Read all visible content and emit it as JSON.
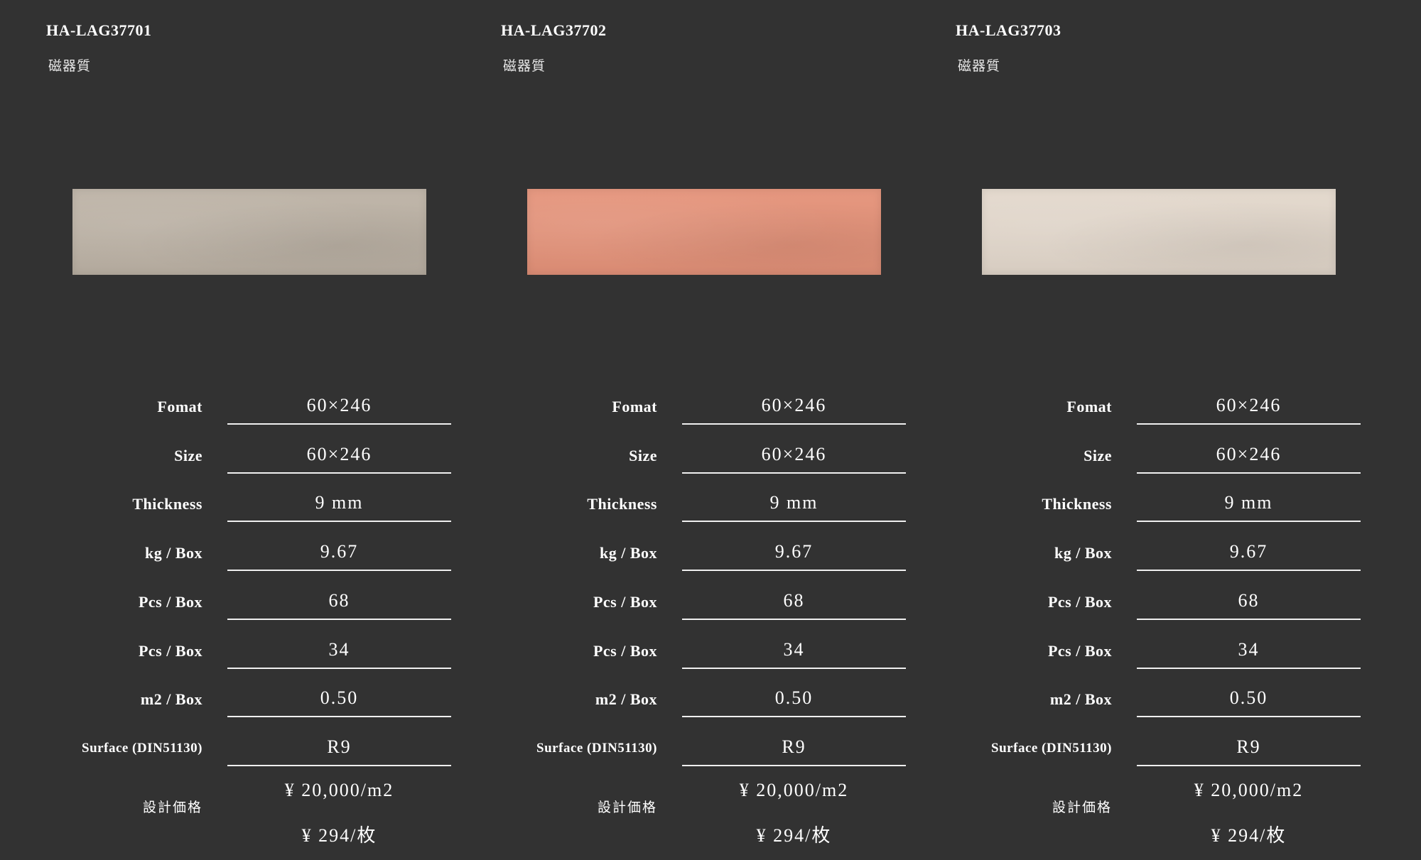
{
  "labels": {
    "format": "Fomat",
    "size": "Size",
    "thickness": "Thickness",
    "kg_box": "kg / Box",
    "pcs_box_1": "Pcs / Box",
    "pcs_box_2": "Pcs / Box",
    "m2_box": "m2 / Box",
    "surface": "Surface (DIN51130)",
    "price": "設計価格"
  },
  "products": [
    {
      "code": "HA-LAG37701",
      "material": "磁器質",
      "swatch_color": "#bdb3a6",
      "format": "60×246",
      "size": "60×246",
      "thickness": "9 mm",
      "kg_box": "9.67",
      "pcs_box_1": "68",
      "pcs_box_2": "34",
      "m2_box": "0.50",
      "surface": "R9",
      "price_m2": "¥ 20,000/m2",
      "price_piece": "¥ 294/枚"
    },
    {
      "code": "HA-LAG37702",
      "material": "磁器質",
      "swatch_color": "#e5937a",
      "format": "60×246",
      "size": "60×246",
      "thickness": "9 mm",
      "kg_box": "9.67",
      "pcs_box_1": "68",
      "pcs_box_2": "34",
      "m2_box": "0.50",
      "surface": "R9",
      "price_m2": "¥ 20,000/m2",
      "price_piece": "¥ 294/枚"
    },
    {
      "code": "HA-LAG37703",
      "material": "磁器質",
      "swatch_color": "#e3d8cc",
      "format": "60×246",
      "size": "60×246",
      "thickness": "9 mm",
      "kg_box": "9.67",
      "pcs_box_1": "68",
      "pcs_box_2": "34",
      "m2_box": "0.50",
      "surface": "R9",
      "price_m2": "¥ 20,000/m2",
      "price_piece": "¥ 294/枚"
    }
  ]
}
